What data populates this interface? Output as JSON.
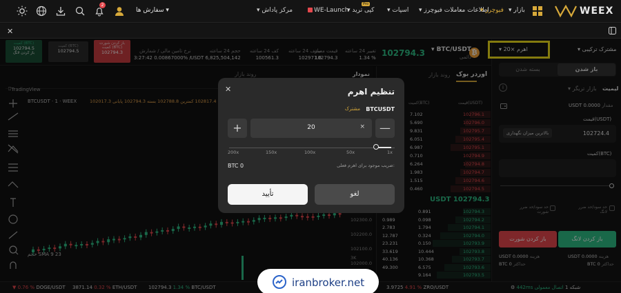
{
  "nav": {
    "brand": "WEEX",
    "items": [
      "بازار",
      "فیوچرز",
      "اطلاعات معاملات فیوچرز",
      "اسپات",
      "کپی ترید",
      "WE-Launch",
      "مرکز پاداش"
    ],
    "copy_badge": "Pro",
    "orders_label": "سفارش ها",
    "notification_count": "2"
  },
  "ticker": {
    "pair": "BTC/USDT",
    "pair_sub": "دائمی",
    "price": "102794.3",
    "stats": [
      {
        "label": "تغییر 24 ساعته",
        "value": "1.34 %"
      },
      {
        "label": "قیمت معیار",
        "value": "102794.3"
      },
      {
        "label": "سقف 24 ساعته",
        "value": "102971.6"
      },
      {
        "label": "کف 24 ساعته",
        "value": "100561.3"
      },
      {
        "label": "حجم 24 ساعته",
        "value": "USDT 6,825,504,142"
      },
      {
        "label": "نرخ تامین مالی / شمارش",
        "value": "3:27:42 0.00867000% /"
      }
    ],
    "leverage_label": "اهرم ×20",
    "margin_mode": "مشترک ترکیبی"
  },
  "quick_trade": {
    "long_label": "باز کردن لانگ",
    "long_sub": "کمیت (BTC)",
    "long_price": "102794.5",
    "short_label": "باز کردن شورت",
    "short_sub": "کمیت (BTC)",
    "short_price": "102794.3"
  },
  "chart": {
    "tab_label": "نمودار",
    "tab2": "اوردر بوک",
    "tab3": "روند بازار",
    "tradingview": "TradingView",
    "symbol_line": "BTCUSDT · 1 · WEEX",
    "ohlc": "102017.3 بیشترین 102817.4 کمترین 102788.8 بسته 102794.3 پایانی",
    "sma": "SMA 9  23",
    "volume_label": "حجم",
    "axis": [
      "102300.0",
      "102200.0",
      "102100.0",
      "102000.0"
    ],
    "axis_bottom": "3K",
    "timeframe_bar": "عمیق   احجام   آریما   کوانس   معاملات"
  },
  "orderbook": {
    "title": "اوردر بوک",
    "tab2": "روند بازار",
    "col_qty": "کمیت(BTC)",
    "col_price": "قیمت(USDT)",
    "asks": [
      [
        "7.102",
        "102796.1"
      ],
      [
        "5.690",
        "102796.0"
      ],
      [
        "9.831",
        "102795.7"
      ],
      [
        "6.051",
        "102795.4"
      ],
      [
        "6.987",
        "102795.1"
      ],
      [
        "0.710",
        "102794.9"
      ],
      [
        "6.264",
        "102794.8"
      ],
      [
        "1.983",
        "102794.7"
      ],
      [
        "1.515",
        "102794.6"
      ],
      [
        "0.460",
        "102794.5"
      ]
    ],
    "mid_price": "USDT 102794.3",
    "bids": [
      [
        "0.891",
        "102794.3"
      ],
      [
        "0.098",
        "102794.2"
      ],
      [
        "1.794",
        "102794.1"
      ],
      [
        "0.324",
        "102794.0"
      ],
      [
        "0.150",
        "102793.9"
      ],
      [
        "10.444",
        "102793.8"
      ],
      [
        "10.368",
        "102793.7"
      ],
      [
        "6.575",
        "102793.6"
      ],
      [
        "9.164",
        "102793.5"
      ]
    ],
    "bid_left": [
      "0.989",
      "2.783",
      "12.787",
      "23.231",
      "33.619",
      "40.136",
      "49.300"
    ],
    "bid_left_top": [
      "0.891"
    ]
  },
  "order_form": {
    "tab_open": "باز شدن",
    "tab_close": "بسته شدن",
    "type_limit": "لیمیت",
    "type_market": "بازار",
    "type_trigger": "تریگر",
    "available_label": "مقدار",
    "available_value": "USDT 0.0000",
    "price_label": "قیمت(USDT)",
    "price_value": "102724.4",
    "price_hint": "بالاترین میزان نگهداری",
    "qty_label": "کمیت(BTC)",
    "tp_label": "حد سود/حد ضرر لانگ",
    "sl_label": "حد سود/حد ضرر شورت",
    "buy_btn": "باز کردن لانگ",
    "sell_btn": "باز کردن شورت",
    "cost_label": "هزینه",
    "cost_value": "USDT 0.0000",
    "max_label": "حداکثر",
    "max_value": "BTC 0"
  },
  "modal": {
    "title": "تنظیم اهرم",
    "symbol": "BTCUSDT",
    "mode": "مشترک",
    "leverage_value": "20",
    "mult_symbol": "×",
    "ticks": [
      "200x",
      "150x",
      "100x",
      "50x",
      "1x"
    ],
    "note": "ضریب موجود برای اهرم فعلی:",
    "note_value": "BTC 0",
    "confirm": "تأیید",
    "cancel": "لغو"
  },
  "bottom": {
    "items": [
      {
        "sym": "DOGE/USDT",
        "pct": "0.76 %"
      },
      {
        "sym": "ETH/USDT",
        "val": "3871.14",
        "pct": "0.32 %"
      },
      {
        "sym": "BTC/USDT",
        "val": "102794.3",
        "pct": "1.34 %"
      },
      {
        "sym": "ZRO/USDT",
        "val": "3.9725",
        "pct": "4.91 %"
      }
    ],
    "latency": "442ms",
    "net_label": "شبکه 1",
    "status": "اتصال معمولی"
  },
  "watermark": "iranbroker.net"
}
